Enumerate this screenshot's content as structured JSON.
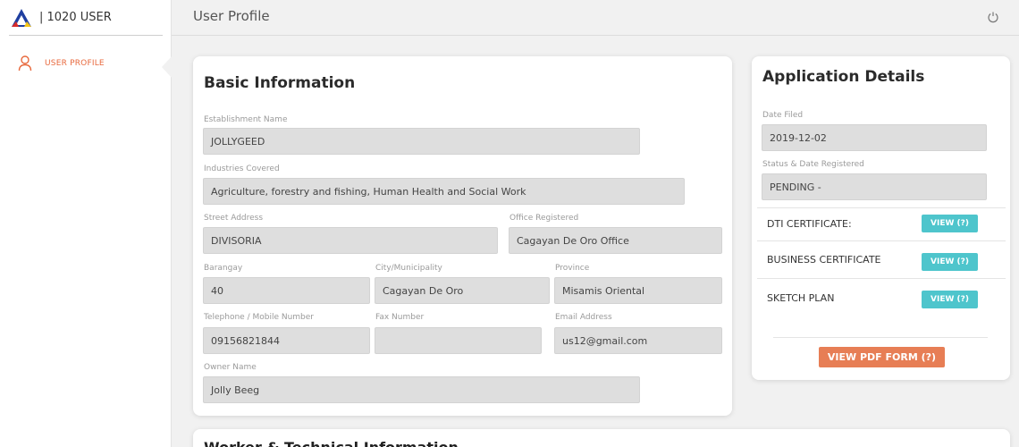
{
  "brand": {
    "label": "| 1020 USER"
  },
  "sidebar": {
    "items": [
      {
        "label": "USER PROFILE"
      }
    ]
  },
  "header": {
    "title": "User Profile"
  },
  "basic": {
    "title": "Basic Information",
    "establishment_name": {
      "label": "Establishment Name",
      "value": "JOLLYGEED"
    },
    "industries": {
      "label": "Industries Covered",
      "value": "Agriculture, forestry and fishing, Human Health and Social Work"
    },
    "street": {
      "label": "Street Address",
      "value": "DIVISORIA"
    },
    "office": {
      "label": "Office Registered",
      "value": "Cagayan De Oro Office"
    },
    "barangay": {
      "label": "Barangay",
      "value": "40"
    },
    "city": {
      "label": "City/Municipality",
      "value": "Cagayan De Oro"
    },
    "province": {
      "label": "Province",
      "value": "Misamis Oriental"
    },
    "telephone": {
      "label": "Telephone / Mobile Number",
      "value": "09156821844"
    },
    "fax": {
      "label": "Fax Number",
      "value": ""
    },
    "email": {
      "label": "Email Address",
      "value": "us12@gmail.com"
    },
    "owner": {
      "label": "Owner Name",
      "value": "Jolly Beeg"
    }
  },
  "application": {
    "title": "Application Details",
    "date_filed": {
      "label": "Date Filed",
      "value": "2019-12-02"
    },
    "status": {
      "label": "Status & Date Registered",
      "value": "PENDING -"
    },
    "documents": [
      {
        "label": "DTI CERTIFICATE:",
        "button": "VIEW (?)"
      },
      {
        "label": "BUSINESS CERTIFICATE",
        "button": "VIEW (?)"
      },
      {
        "label": "SKETCH PLAN",
        "button": "VIEW (?)"
      }
    ],
    "pdf_button": "VIEW PDF FORM (?)"
  },
  "next_section": {
    "title": "Worker & Technical Information"
  },
  "colors": {
    "accent_orange": "#e8693d",
    "view_button": "#4ec5cc",
    "pdf_button": "#e77e55"
  },
  "icons": {
    "user": "user-icon",
    "power": "power-icon",
    "logo": "dole-logo"
  }
}
